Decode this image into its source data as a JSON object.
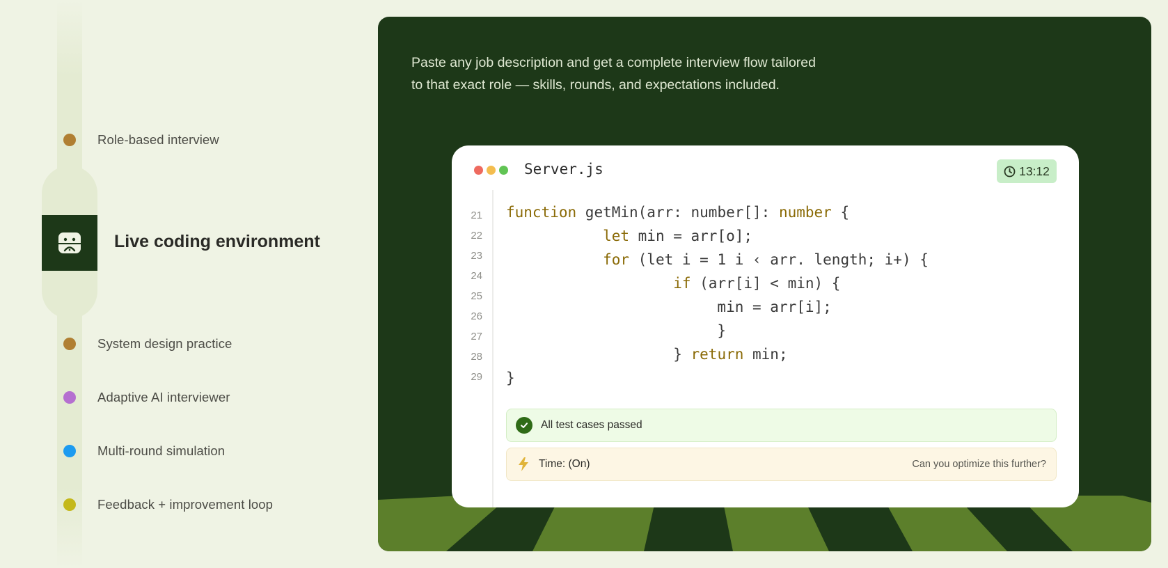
{
  "timeline": {
    "items_top": [
      {
        "label": "Role-based interview",
        "color": "#b07f32"
      }
    ],
    "active": {
      "label": "Live coding environment",
      "icon": "coding-face-icon",
      "bg": "#1d3818"
    },
    "items_bottom": [
      {
        "label": "System design practice",
        "color": "#b07f32"
      },
      {
        "label": "Adaptive AI interviewer",
        "color": "#b56fd0"
      },
      {
        "label": "Multi-round simulation",
        "color": "#1c9bf0"
      },
      {
        "label": "Feedback + improvement loop",
        "color": "#c4b81a"
      }
    ]
  },
  "panel": {
    "description_line1": "Paste any job description and get a complete interview flow tailored",
    "description_line2": "to that exact role — skills, rounds, and expectations included.",
    "bg_color": "#1d3818",
    "stripe_color": "#5c7f2b"
  },
  "editor": {
    "file_name": "Server.js",
    "timer": "13:12",
    "timer_icon": "clock-icon",
    "line_numbers": [
      "21",
      "22",
      "23",
      "24",
      "25",
      "26",
      "27",
      "28",
      "29"
    ],
    "code_lines": [
      [
        {
          "t": "function",
          "k": true
        },
        {
          "t": " getMin(arr: number[]: ",
          "k": false
        },
        {
          "t": "number",
          "k": true
        },
        {
          "t": " {",
          "k": false
        }
      ],
      [
        {
          "t": "           ",
          "k": false
        },
        {
          "t": "let",
          "k": true
        },
        {
          "t": " min = arr[o];",
          "k": false
        }
      ],
      [
        {
          "t": "           ",
          "k": false
        },
        {
          "t": "for",
          "k": true
        },
        {
          "t": " (let i = 1 i ‹ arr. length; i+) {",
          "k": false
        }
      ],
      [
        {
          "t": "                   ",
          "k": false
        },
        {
          "t": "if",
          "k": true
        },
        {
          "t": " (arr[i] < min) {",
          "k": false
        }
      ],
      [
        {
          "t": "                        min = arr[i];",
          "k": false
        }
      ],
      [
        {
          "t": "                        }",
          "k": false
        }
      ],
      [
        {
          "t": "                   } ",
          "k": false
        },
        {
          "t": "return",
          "k": true
        },
        {
          "t": " min;",
          "k": false
        }
      ],
      [
        {
          "t": "}",
          "k": false
        }
      ]
    ],
    "pass_status": "All test cases passed",
    "time_status": "Time: (On)",
    "hint": "Can you optimize this further?"
  }
}
